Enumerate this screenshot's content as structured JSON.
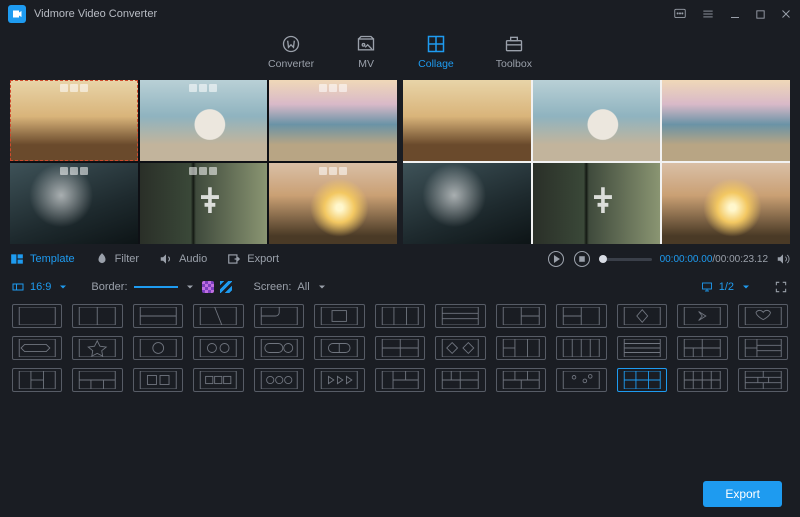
{
  "app": {
    "title": "Vidmore Video Converter"
  },
  "topnav": {
    "converter": "Converter",
    "mv": "MV",
    "collage": "Collage",
    "toolbox": "Toolbox"
  },
  "subtabs": {
    "template": "Template",
    "filter": "Filter",
    "audio": "Audio",
    "export": "Export"
  },
  "timeline": {
    "current": "00:00:00.00",
    "total": "00:00:23.12"
  },
  "options": {
    "aspect_label": "16:9",
    "border_label": "Border:",
    "screen_label": "Screen:",
    "screen_value": "All",
    "zoom_value": "1/2"
  },
  "footer": {
    "export": "Export"
  }
}
